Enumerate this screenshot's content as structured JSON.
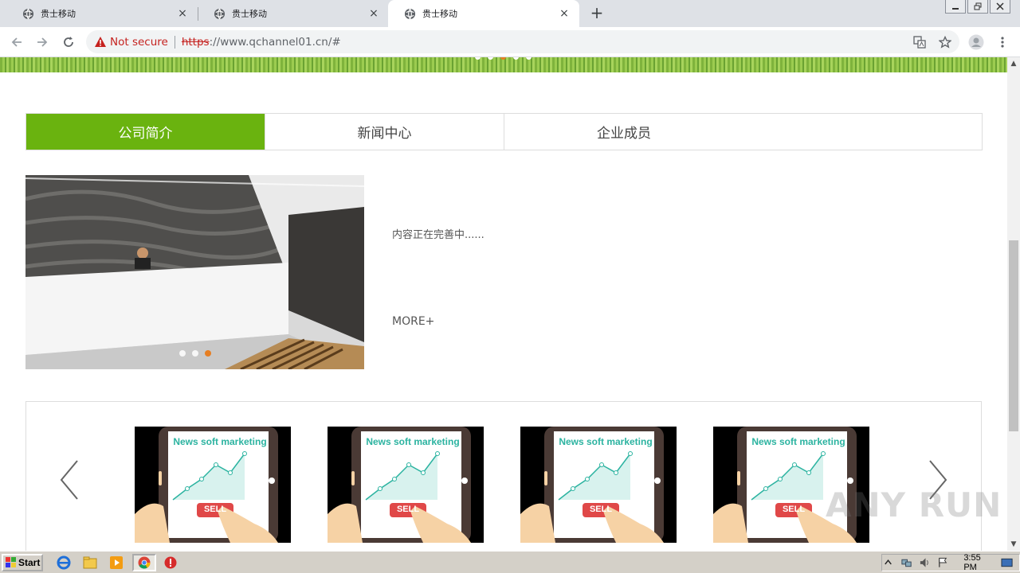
{
  "browser": {
    "tabs": [
      {
        "title": "贵士移动"
      },
      {
        "title": "贵士移动"
      },
      {
        "title": "贵士移动"
      }
    ],
    "active_tab": 2,
    "new_tab_label": "+",
    "close_glyph": "×",
    "address": {
      "security_label": "Not secure",
      "scheme": "https",
      "rest": "://www.qchannel01.cn/#"
    }
  },
  "page": {
    "banner_slide_count": 5,
    "banner_active_slide": 2,
    "tabs": [
      {
        "label": "公司简介"
      },
      {
        "label": "新闻中心"
      },
      {
        "label": "企业成员"
      }
    ],
    "active_tab": 0,
    "intro_text": "内容正在完善中......",
    "more_label": "MORE+",
    "image_slide_count": 3,
    "image_active_slide": 2,
    "cards": [
      {
        "caption": "News soft marketing",
        "button": "SELL"
      },
      {
        "caption": "News soft marketing",
        "button": "SELL"
      },
      {
        "caption": "News soft marketing",
        "button": "SELL"
      },
      {
        "caption": "News soft marketing",
        "button": "SELL"
      }
    ]
  },
  "taskbar": {
    "start_label": "Start",
    "clock": "3:55 PM"
  },
  "watermark": "ANY RUN",
  "colors": {
    "accent_green": "#6ab30f",
    "warning_red": "#c5221f",
    "active_dot": "#e67e22"
  }
}
